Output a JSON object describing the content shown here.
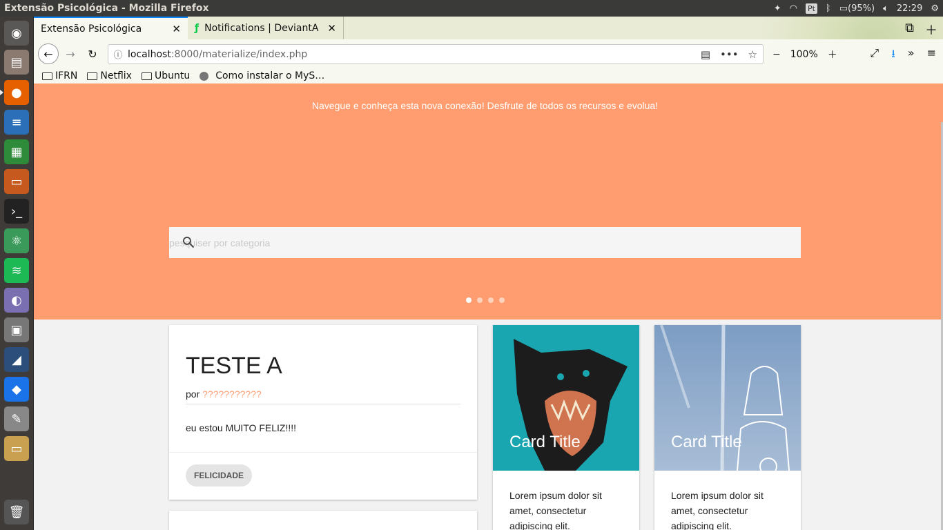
{
  "os": {
    "window_title": "Extensão Psicológica - Mozilla Firefox",
    "battery": "(95%)",
    "keyboard": "Pt",
    "clock": "22:29"
  },
  "browser": {
    "tabs": [
      {
        "label": "Extensão Psicológica",
        "active": true
      },
      {
        "label": "Notifications | DeviantA",
        "active": false
      }
    ],
    "url_host": "localhost",
    "url_path": ":8000/materialize/index.php",
    "zoom": "100%",
    "bookmarks": [
      {
        "label": "IFRN",
        "icon": "folder-icon"
      },
      {
        "label": "Netflix",
        "icon": "folder-icon"
      },
      {
        "label": "Ubuntu",
        "icon": "folder-icon"
      },
      {
        "label": "Como instalar o MyS…",
        "icon": "globe-icon"
      }
    ]
  },
  "page": {
    "hero_text": "Navegue e conheça esta nova conexão! Desfrute de todos os recursos e evolua!",
    "search_placeholder": "pesquiser por categoria",
    "slider_dots": 4,
    "colors": {
      "accent": "#ff9d70",
      "teal": "#1aa6b0",
      "sky": "#8fa9c8"
    },
    "post": {
      "title": "TESTE A",
      "by": "por",
      "author": "???????????",
      "text": "eu estou MUITO FELIZ!!!!",
      "tag": "FELICIDADE"
    },
    "cards": [
      {
        "title": "Card Title",
        "text": "Lorem ipsum dolor sit amet, consectetur adipiscing elit."
      },
      {
        "title": "Card Title",
        "text": "Lorem ipsum dolor sit amet, consectetur adipiscing elit."
      }
    ]
  }
}
